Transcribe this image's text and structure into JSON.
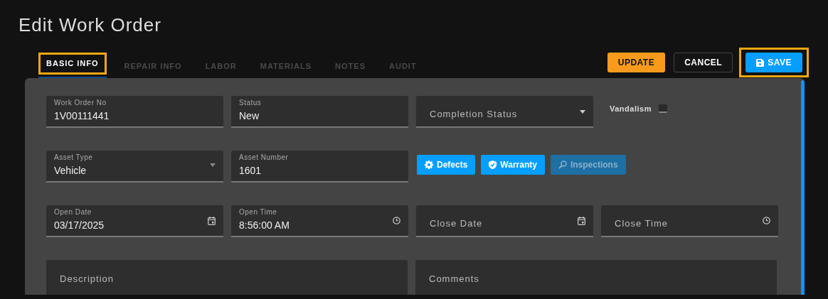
{
  "page_title": "Edit Work Order",
  "tabs": [
    {
      "label": "BASIC INFO",
      "selected": true,
      "highlighted": true
    },
    {
      "label": "REPAIR INFO",
      "selected": false,
      "highlighted": false
    },
    {
      "label": "LABOR",
      "selected": false,
      "highlighted": false
    },
    {
      "label": "MATERIALS",
      "selected": false,
      "highlighted": false
    },
    {
      "label": "NOTES",
      "selected": false,
      "highlighted": false
    },
    {
      "label": "AUDIT",
      "selected": false,
      "highlighted": false
    }
  ],
  "actions": [
    {
      "label": "UPDATE",
      "kind": "update",
      "highlighted": false
    },
    {
      "label": "CANCEL",
      "kind": "cancel",
      "highlighted": false
    },
    {
      "label": "SAVE",
      "kind": "save",
      "highlighted": true
    }
  ],
  "form_rows": [
    [
      {
        "kind": "text",
        "label": "Work Order No",
        "value": "1V00111441"
      },
      {
        "kind": "text",
        "label": "Status",
        "value": "New"
      },
      {
        "kind": "select",
        "label": "Completion Status"
      },
      {
        "kind": "checkbox",
        "label": "Vandalism",
        "checked": false
      }
    ],
    [
      {
        "kind": "select",
        "label": "Asset Type",
        "value": "Vehicle"
      },
      {
        "kind": "text",
        "label": "Asset Number",
        "value": "1601"
      },
      {
        "kind": "buttons",
        "buttons": [
          {
            "label": "Defects",
            "disabled": false
          },
          {
            "label": "Warranty",
            "disabled": false
          },
          {
            "label": "Inspections",
            "disabled": true
          }
        ]
      }
    ],
    [
      {
        "kind": "date",
        "label": "Open Date",
        "value": "03/17/2025"
      },
      {
        "kind": "time",
        "label": "Open Time",
        "value": "8:56:00 AM"
      },
      {
        "kind": "date",
        "label": "Close Date"
      },
      {
        "kind": "time",
        "label": "Close Time"
      }
    ],
    [
      {
        "kind": "textarea",
        "label": "Description"
      },
      {
        "kind": "textarea",
        "label": "Comments"
      }
    ]
  ]
}
